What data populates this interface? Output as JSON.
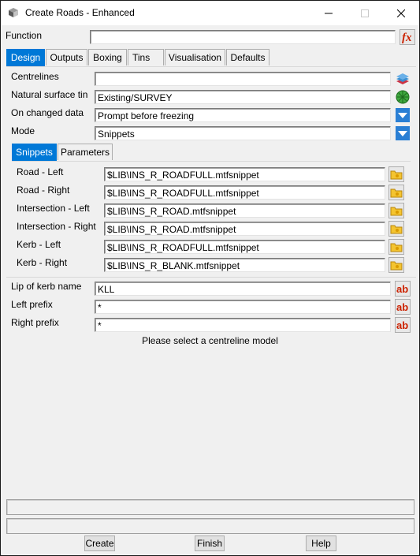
{
  "window": {
    "title": "Create Roads - Enhanced"
  },
  "function_row": {
    "label": "Function",
    "value": ""
  },
  "main_tabs": [
    "Design",
    "Outputs",
    "Boxing",
    "Tins",
    "Visualisation",
    "Defaults"
  ],
  "design": {
    "centrelines": {
      "label": "Centrelines",
      "value": ""
    },
    "natural_surface_tin": {
      "label": "Natural surface tin",
      "value": "Existing/SURVEY"
    },
    "on_changed_data": {
      "label": "On changed data",
      "value": "Prompt before freezing"
    },
    "mode": {
      "label": "Mode",
      "value": "Snippets"
    }
  },
  "sub_tabs": [
    "Snippets",
    "Parameters"
  ],
  "snippets": [
    {
      "label": "Road - Left",
      "value": "$LIB\\INS_R_ROADFULL.mtfsnippet"
    },
    {
      "label": "Road - Right",
      "value": "$LIB\\INS_R_ROADFULL.mtfsnippet"
    },
    {
      "label": "Intersection - Left",
      "value": "$LIB\\INS_R_ROAD.mtfsnippet"
    },
    {
      "label": "Intersection - Right",
      "value": "$LIB\\INS_R_ROAD.mtfsnippet"
    },
    {
      "label": "Kerb - Left",
      "value": "$LIB\\INS_R_ROADFULL.mtfsnippet"
    },
    {
      "label": "Kerb - Right",
      "value": "$LIB\\INS_R_BLANK.mtfsnippet"
    }
  ],
  "lip_of_kerb": {
    "label": "Lip of kerb name",
    "value": "KLL"
  },
  "left_prefix": {
    "label": "Left prefix",
    "value": "*"
  },
  "right_prefix": {
    "label": "Right prefix",
    "value": "*"
  },
  "message": "Please select a centreline model",
  "buttons": {
    "create": "Create",
    "finish": "Finish",
    "help": "Help"
  },
  "colors": {
    "accent": "#0078d7",
    "text_icon": "#cc2200"
  },
  "icons": {
    "function": "fx-icon",
    "centrelines": "layers-icon",
    "tin": "tin-globe-icon",
    "dropdown": "triangle-down-icon",
    "file": "folder-icon",
    "text": "ab-text-icon"
  }
}
